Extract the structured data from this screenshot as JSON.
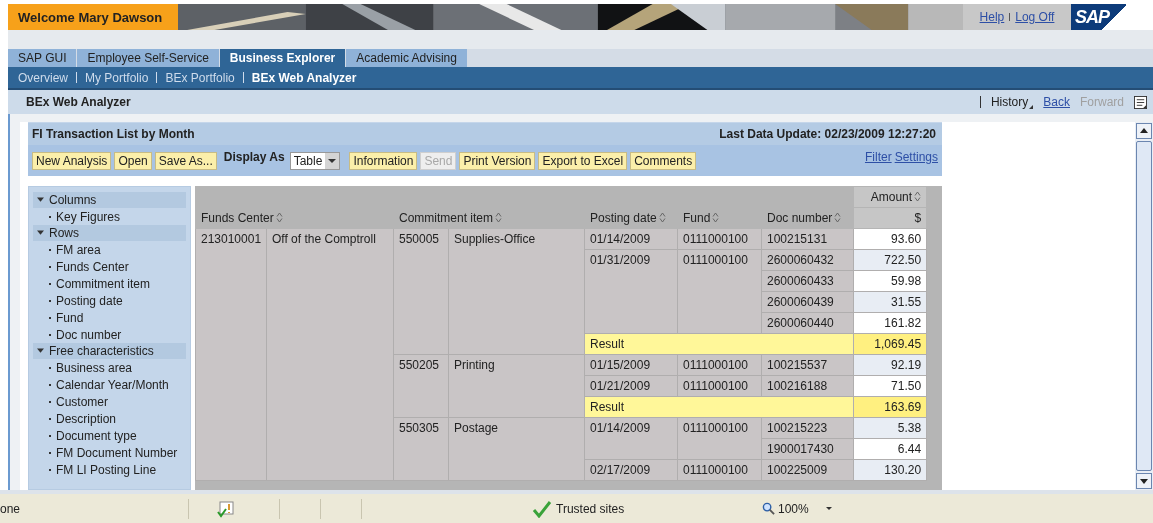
{
  "header": {
    "welcome": "Welcome Mary Dawson",
    "links": [
      "Help",
      "Log Off"
    ],
    "logo": "SAP"
  },
  "tabs": [
    {
      "label": "SAP GUI",
      "selected": false
    },
    {
      "label": "Employee Self-Service",
      "selected": false
    },
    {
      "label": "Business Explorer",
      "selected": true
    },
    {
      "label": "Academic Advising",
      "selected": false
    }
  ],
  "subnav": [
    {
      "label": "Overview",
      "selected": false
    },
    {
      "label": "My Portfolio",
      "selected": false
    },
    {
      "label": "BEx Portfolio",
      "selected": false
    },
    {
      "label": "BEx Web Analyzer",
      "selected": true
    }
  ],
  "page_title": "BEx Web Analyzer",
  "history": {
    "label": "History",
    "back": "Back",
    "forward": "Forward",
    "forward_disabled": true
  },
  "report": {
    "title": "FI Transaction List by Month",
    "last_update": "Last Data Update: 02/23/2009 12:27:20",
    "toolbar": [
      {
        "kind": "button",
        "label": "New Analysis",
        "disabled": false
      },
      {
        "kind": "button",
        "label": "Open",
        "disabled": false
      },
      {
        "kind": "button",
        "label": "Save As...",
        "disabled": false
      },
      {
        "kind": "select",
        "label": "Display As",
        "value": "Table"
      },
      {
        "kind": "button",
        "label": "Information",
        "disabled": false
      },
      {
        "kind": "button",
        "label": "Send",
        "disabled": true
      },
      {
        "kind": "button",
        "label": "Print Version",
        "disabled": false
      },
      {
        "kind": "button",
        "label": "Export to Excel",
        "disabled": false
      },
      {
        "kind": "button",
        "label": "Comments",
        "disabled": false
      }
    ],
    "links": [
      "Filter",
      "Settings"
    ],
    "navigation": [
      {
        "label": "Columns",
        "expanded": true,
        "children": [
          "Key Figures"
        ]
      },
      {
        "label": "Rows",
        "expanded": true,
        "children": [
          "FM area",
          "Funds Center",
          "Commitment item",
          "Posting date",
          "Fund",
          "Doc number"
        ]
      },
      {
        "label": "Free characteristics",
        "expanded": true,
        "children": [
          "Business area",
          "Calendar Year/Month",
          "Customer",
          "Description",
          "Document type",
          "FM Document Number",
          "FM LI Posting Line"
        ]
      }
    ],
    "table": {
      "columns": [
        "Funds Center",
        "Commitment item",
        "Posting date",
        "Fund",
        "Doc number",
        "Amount"
      ],
      "unit": "$",
      "funds_center": {
        "code": "213010001",
        "name": "Off of the Comptroll",
        "items": [
          {
            "code": "550005",
            "name": "Supplies-Office",
            "result_label": "Result",
            "result": "1,069.45",
            "dates": [
              {
                "date": "01/14/2009",
                "fund": "0111000100",
                "docs": [
                  {
                    "number": "100215131",
                    "amount": "93.60"
                  }
                ]
              },
              {
                "date": "01/31/2009",
                "fund": "0111000100",
                "docs": [
                  {
                    "number": "2600060432",
                    "amount": "722.50"
                  },
                  {
                    "number": "2600060433",
                    "amount": "59.98"
                  },
                  {
                    "number": "2600060439",
                    "amount": "31.55"
                  },
                  {
                    "number": "2600060440",
                    "amount": "161.82"
                  }
                ]
              }
            ]
          },
          {
            "code": "550205",
            "name": "Printing",
            "result_label": "Result",
            "result": "163.69",
            "dates": [
              {
                "date": "01/15/2009",
                "fund": "0111000100",
                "docs": [
                  {
                    "number": "100215537",
                    "amount": "92.19"
                  }
                ]
              },
              {
                "date": "01/21/2009",
                "fund": "0111000100",
                "docs": [
                  {
                    "number": "100216188",
                    "amount": "71.50"
                  }
                ]
              }
            ]
          },
          {
            "code": "550305",
            "name": "Postage",
            "dates": [
              {
                "date": "01/14/2009",
                "fund": "0111000100",
                "docs": [
                  {
                    "number": "100215223",
                    "amount": "5.38"
                  },
                  {
                    "number": "1900017430",
                    "amount": "6.44"
                  }
                ]
              },
              {
                "date": "02/17/2009",
                "fund": "0111000100",
                "docs": [
                  {
                    "number": "100225009",
                    "amount": "130.20"
                  }
                ]
              }
            ]
          }
        ]
      }
    }
  },
  "status_bar": {
    "status": "one",
    "zone": "Trusted sites",
    "zoom": "100%"
  }
}
